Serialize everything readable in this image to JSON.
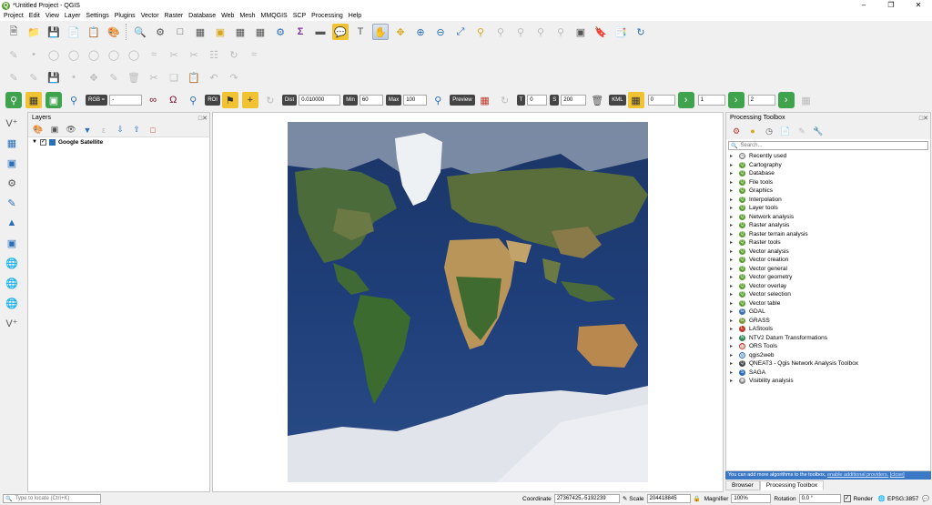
{
  "window": {
    "title": "*Untitled Project - QGIS",
    "controls": [
      "–",
      "❐",
      "✕"
    ]
  },
  "menu": [
    "Project",
    "Edit",
    "View",
    "Layer",
    "Settings",
    "Plugins",
    "Vector",
    "Raster",
    "Database",
    "Web",
    "Mesh",
    "MMQGIS",
    "SCP",
    "Processing",
    "Help"
  ],
  "scp_toolbar": {
    "band_set": "RGB =",
    "band_value": "-",
    "roi_label": "ROI",
    "dist_label": "Dist",
    "dist_value": "0.010000",
    "min_label": "Min",
    "min_value": "60",
    "max_label": "Max",
    "max_value": "100",
    "preview_label": "Preview",
    "field_t": "0",
    "field_s": "200",
    "kml_label": "KML",
    "field_a": "0",
    "field_b": "1",
    "field_c": "2"
  },
  "layers_panel": {
    "title": "Layers",
    "layers": [
      {
        "name": "Google Satellite",
        "checked": true
      }
    ]
  },
  "processing_toolbox": {
    "title": "Processing Toolbox",
    "search_placeholder": "Search...",
    "items": [
      "Recently used",
      "Cartography",
      "Database",
      "File tools",
      "Graphics",
      "Interpolation",
      "Layer tools",
      "Network analysis",
      "Raster analysis",
      "Raster terrain analysis",
      "Raster tools",
      "Vector analysis",
      "Vector creation",
      "Vector general",
      "Vector geometry",
      "Vector overlay",
      "Vector selection",
      "Vector table",
      "GDAL",
      "GRASS",
      "LAStools",
      "NTV2 Datum Transformations",
      "ORS Tools",
      "qgis2web",
      "QNEAT3 - Qgis Network Analysis Toolbox",
      "SAGA",
      "Visibility analysis"
    ],
    "info_text": "You can add more algorithms to the toolbox,",
    "info_link": "enable additional providers.",
    "info_close": "[close]"
  },
  "bottom_tabs": [
    "Browser",
    "Processing Toolbox"
  ],
  "status": {
    "locate_placeholder": "Type to locate (Ctrl+K)",
    "coordinate_label": "Coordinate",
    "coordinate_value": "27367425,-5192239",
    "scale_label": "Scale",
    "scale_value": "204418845",
    "magnifier_label": "Magnifier",
    "magnifier_value": "100%",
    "rotation_label": "Rotation",
    "rotation_value": "0.0 °",
    "render_label": "Render",
    "crs": "EPSG:3857"
  }
}
